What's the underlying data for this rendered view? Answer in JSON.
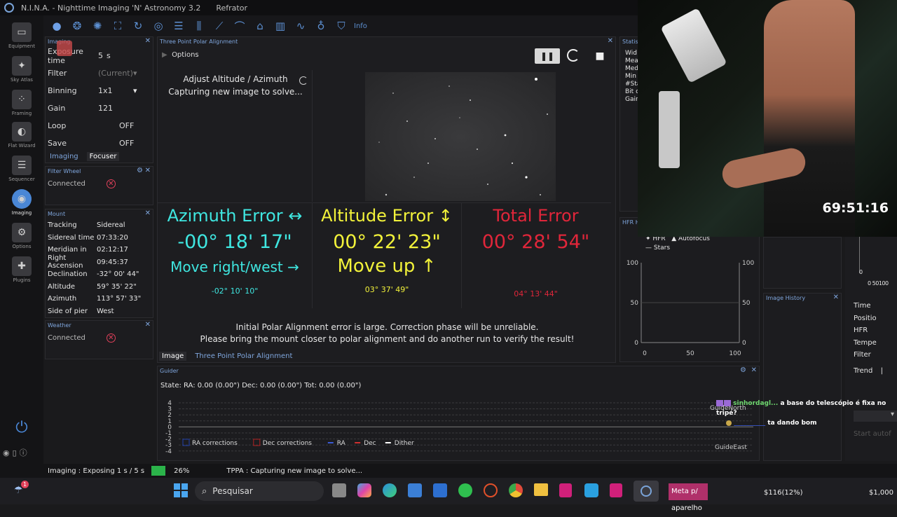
{
  "window": {
    "title": "N.I.N.A. - Nighttime Imaging 'N' Astronomy 3.2",
    "profile": "Refrator"
  },
  "sidebar": {
    "items": [
      {
        "label": "Equipment"
      },
      {
        "label": "Sky Atlas"
      },
      {
        "label": "Framing"
      },
      {
        "label": "Flat Wizard"
      },
      {
        "label": "Sequencer"
      },
      {
        "label": "Imaging"
      },
      {
        "label": "Options"
      },
      {
        "label": "Plugins"
      }
    ],
    "collapse_label": "< <"
  },
  "toolbar": {
    "info_label": "Info"
  },
  "imaging_panel": {
    "title": "Imaging",
    "exposure_label": "Exposure time",
    "exposure_value": "5",
    "exposure_unit": "s",
    "filter_label": "Filter",
    "filter_value": "(Current)",
    "binning_label": "Binning",
    "binning_value": "1x1",
    "gain_label": "Gain",
    "gain_value": "121",
    "loop_label": "Loop",
    "loop_value": "OFF",
    "save_label": "Save",
    "save_value": "OFF",
    "tabs": [
      "Imaging",
      "Focuser"
    ]
  },
  "filter_wheel": {
    "title": "Filter Wheel",
    "status": "Connected"
  },
  "mount": {
    "title": "Mount",
    "rows": [
      {
        "k": "Tracking",
        "v": "Sidereal"
      },
      {
        "k": "Sidereal time",
        "v": "07:33:20"
      },
      {
        "k": "Meridian in",
        "v": "02:12:17"
      },
      {
        "k": "Right Ascension",
        "v": "09:45:37"
      },
      {
        "k": "Declination",
        "v": "-32° 00' 44\""
      },
      {
        "k": "Altitude",
        "v": "59° 35' 22\""
      },
      {
        "k": "Azimuth",
        "v": "113° 57' 33\""
      },
      {
        "k": "Side of pier",
        "v": "West"
      }
    ]
  },
  "weather": {
    "title": "Weather",
    "status": "Connected"
  },
  "tppa": {
    "title": "Three Point Polar Alignment",
    "options_label": "Options",
    "step": "Adjust Altitude / Azimuth",
    "status": "Capturing new image to solve...",
    "azimuth": {
      "label": "Azimuth Error",
      "arrow": "↔",
      "value": "-00° 18' 17\"",
      "move": "Move right/west",
      "move_arrow": "→",
      "sub": "-02° 10' 10\""
    },
    "altitude": {
      "label": "Altitude Error",
      "arrow": "↕",
      "value": "00° 22' 23\"",
      "move": "Move up",
      "move_arrow": "↑",
      "sub": "03° 37' 49\""
    },
    "total": {
      "label": "Total Error",
      "value": "00° 28' 54\"",
      "sub": "04° 13' 44\""
    },
    "warning1": "Initial Polar Alignment error is large. Correction phase will be unreliable.",
    "warning2": "Please bring the mount closer to polar alignment and do another run to verify the result!",
    "tabs": [
      "Image",
      "Three Point Polar Alignment"
    ]
  },
  "statistics": {
    "title": "Statistics",
    "rows": [
      "Wid",
      "Mea",
      "Med",
      "Min",
      "#Sta",
      "Bit c",
      "Gain"
    ]
  },
  "hfr_history": {
    "title": "HFR History",
    "legend": [
      "HFR",
      "Autofocus",
      "Stars"
    ],
    "y_ticks_left": [
      "100",
      "50",
      "0"
    ],
    "y_ticks_right": [
      "100",
      "50",
      "0"
    ],
    "x_ticks": [
      "0",
      "50",
      "100"
    ]
  },
  "image_history": {
    "title": "Image History"
  },
  "right_col": {
    "rows": [
      "Time",
      "Positio",
      "HFR",
      "Tempe",
      "Filter"
    ],
    "trend_label": "Trend",
    "start_label": "Start autof",
    "mini_ticks": [
      "0",
      "0",
      "50",
      "100"
    ]
  },
  "guider": {
    "title": "Guider",
    "state": "State:  RA: 0.00 (0.00\")  Dec: 0.00 (0.00\")  Tot: 0.00 (0.00\")",
    "y_ticks": [
      "4",
      "3",
      "2",
      "1",
      "0",
      "-1",
      "-2",
      "-3",
      "-4"
    ],
    "north_label": "GuideNorth",
    "east_label": "GuideEast",
    "legend": [
      {
        "label": "RA corrections",
        "color": "#1f3fa8"
      },
      {
        "label": "Dec corrections",
        "color": "#b02020"
      },
      {
        "label": "RA",
        "color": "#3b5bd6"
      },
      {
        "label": "Dec",
        "color": "#d03030"
      },
      {
        "label": "Dither",
        "color": "#ffffff"
      }
    ]
  },
  "stream": {
    "timer": "69:51:16",
    "chat": [
      {
        "user": "sinhordagl...",
        "msg": "a base do telescópio é fixa no tripé?"
      },
      {
        "user": "__________",
        "msg": "ta dando bom"
      }
    ]
  },
  "status_bar": {
    "imaging": "Imaging :   Exposing 1 s / 5 s",
    "progress": 0.26,
    "progress_label": "26%",
    "tppa": "TPPA :   Capturing new image to solve..."
  },
  "taskbar": {
    "search_placeholder": "Pesquisar",
    "notification": "Meta p/ aparelho",
    "stock1": "$116(12%)",
    "stock2": "$1,000",
    "badge": "1"
  },
  "colors": {
    "azimuth": "#3fe6e0",
    "altitude": "#f2f23a",
    "total": "#e0263a",
    "accent": "#4a87d6"
  }
}
